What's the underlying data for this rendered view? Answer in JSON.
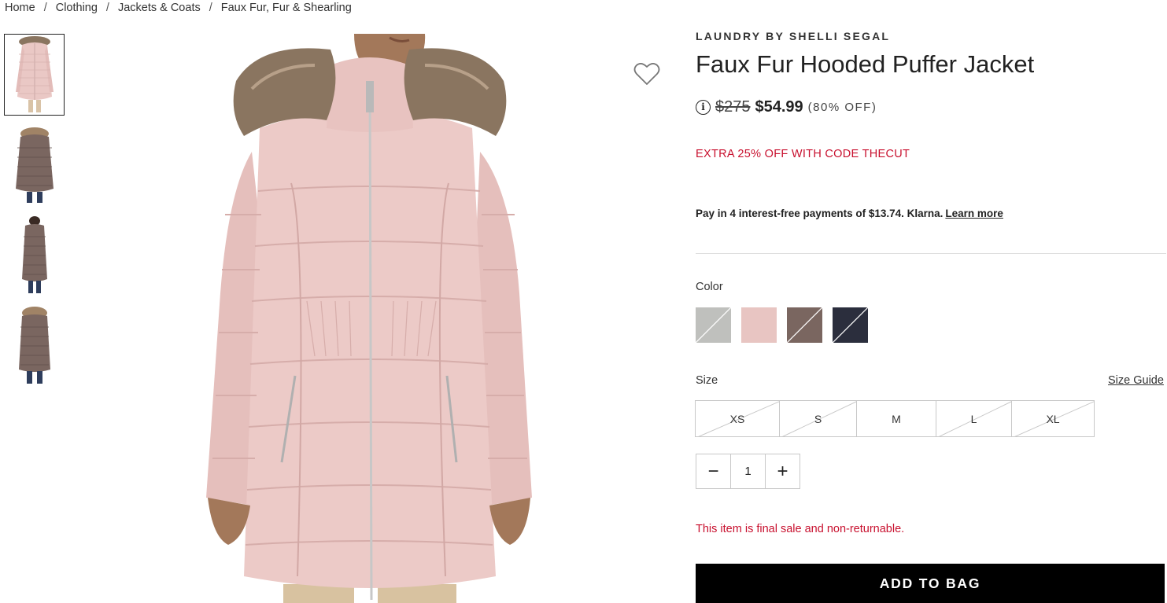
{
  "breadcrumb": [
    {
      "label": "Home"
    },
    {
      "label": "Clothing"
    },
    {
      "label": "Jackets & Coats"
    },
    {
      "label": "Faux Fur, Fur & Shearling"
    }
  ],
  "breadcrumb_separator": "/",
  "thumbnails": [
    {
      "name": "pink-front",
      "coat_color": "#e9c6c4",
      "active": true
    },
    {
      "name": "taupe-back",
      "coat_color": "#7a6660",
      "active": false
    },
    {
      "name": "taupe-side",
      "coat_color": "#7a6660",
      "active": false
    },
    {
      "name": "taupe-hood",
      "coat_color": "#7a6660",
      "active": false
    }
  ],
  "product": {
    "brand": "LAUNDRY BY SHELLI SEGAL",
    "title": "Faux Fur Hooded Puffer Jacket",
    "info_icon": "i",
    "original_price": "$275",
    "sale_price": "$54.99",
    "discount": "(80% OFF)",
    "promo": "EXTRA 25% OFF WITH CODE THECUT",
    "klarna_text": "Pay in 4 interest-free payments of $13.74. Klarna.",
    "klarna_link": "Learn more",
    "color_label": "Color",
    "colors": [
      {
        "name": "gray",
        "hex": "#bfc0bd",
        "unavailable": true
      },
      {
        "name": "pink",
        "hex": "#e8c5c2",
        "unavailable": false
      },
      {
        "name": "taupe",
        "hex": "#7a6660",
        "unavailable": true
      },
      {
        "name": "navy",
        "hex": "#2b2e3d",
        "unavailable": true
      }
    ],
    "size_label": "Size",
    "size_guide": "Size Guide",
    "sizes": [
      {
        "label": "XS",
        "unavailable": true
      },
      {
        "label": "S",
        "unavailable": true
      },
      {
        "label": "M",
        "unavailable": false
      },
      {
        "label": "L",
        "unavailable": true
      },
      {
        "label": "XL",
        "unavailable": true
      }
    ],
    "quantity": "1",
    "qty_minus": "−",
    "qty_plus": "+",
    "final_sale": "This item is final sale and non-returnable.",
    "add_to_bag": "ADD TO BAG"
  },
  "colors": {
    "accent_red": "#c8102e",
    "button_black": "#000000",
    "coat_pink": "#eac8c5",
    "fur": "#8a7560"
  },
  "icons": {
    "favorite": "heart-outline-icon",
    "info": "info-circle-icon"
  }
}
